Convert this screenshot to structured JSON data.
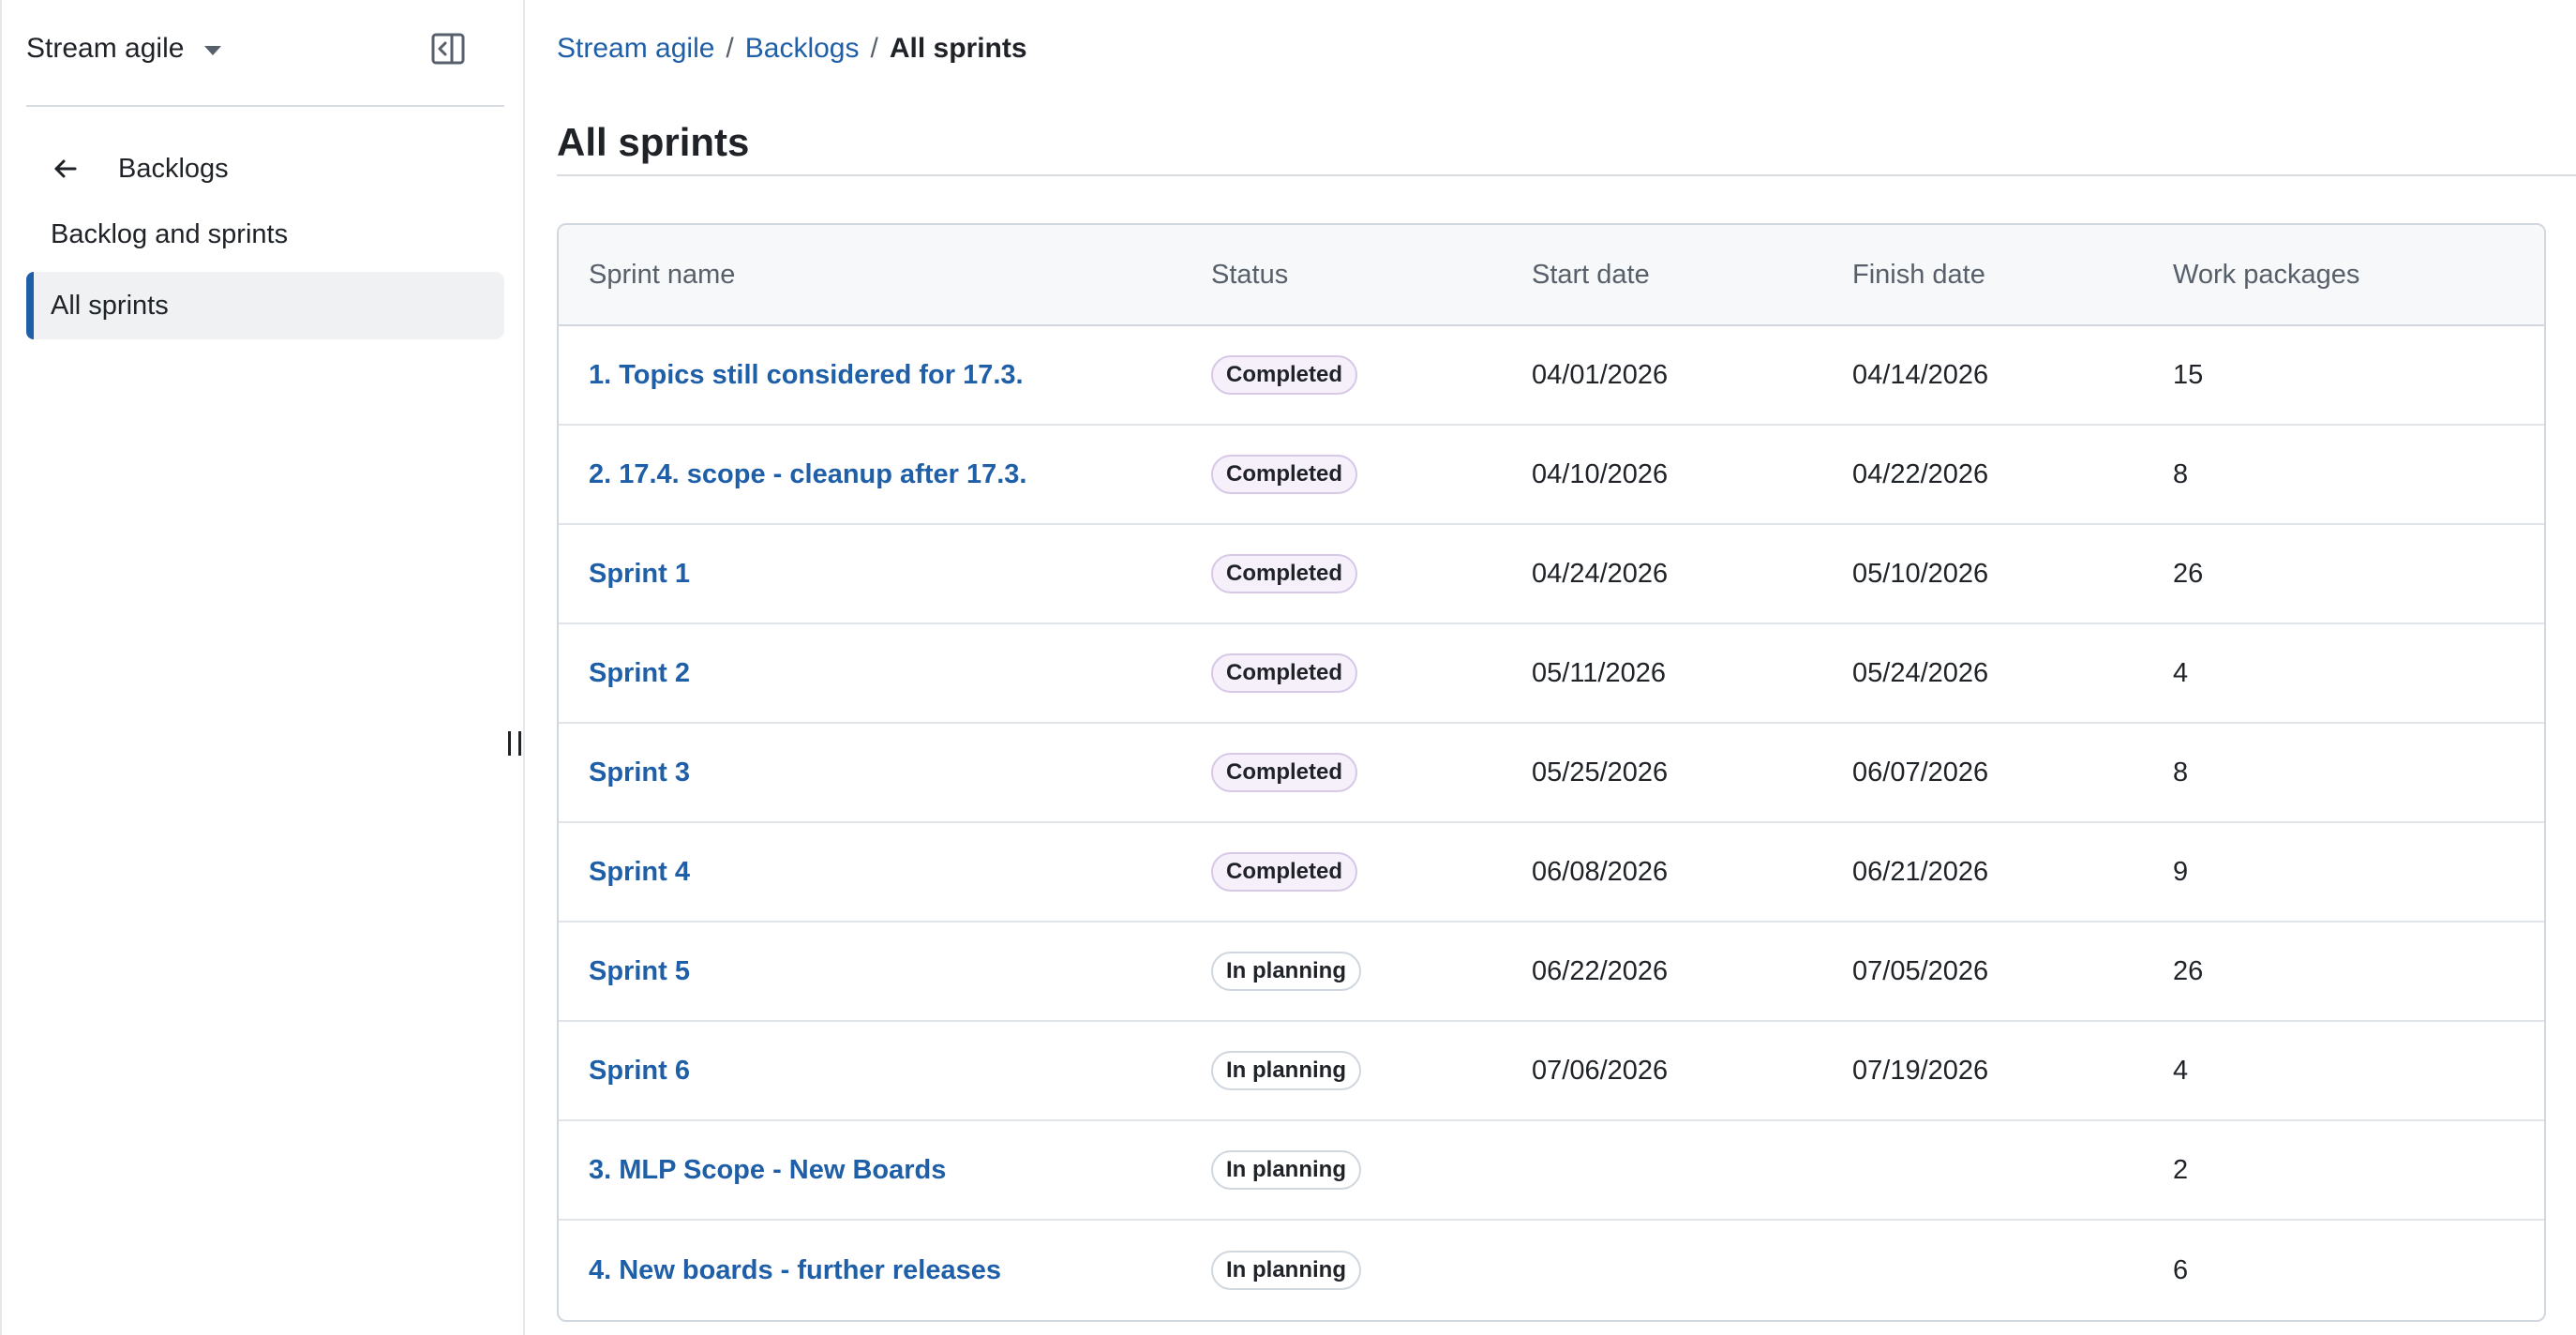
{
  "sidebar": {
    "project_name": "Stream agile",
    "back_label": "Backlogs",
    "nav": [
      {
        "label": "Backlog and sprints",
        "active": false
      },
      {
        "label": "All sprints",
        "active": true
      }
    ]
  },
  "breadcrumb": {
    "items": [
      "Stream agile",
      "Backlogs"
    ],
    "current": "All sprints",
    "separator": "/"
  },
  "page": {
    "title": "All sprints"
  },
  "table": {
    "headers": [
      "Sprint name",
      "Status",
      "Start date",
      "Finish date",
      "Work packages"
    ],
    "rows": [
      {
        "name": "1. Topics still considered for 17.3.",
        "status": "Completed",
        "start": "04/01/2026",
        "finish": "04/14/2026",
        "work_packages": "15"
      },
      {
        "name": "2. 17.4. scope - cleanup after 17.3.",
        "status": "Completed",
        "start": "04/10/2026",
        "finish": "04/22/2026",
        "work_packages": "8"
      },
      {
        "name": "Sprint 1",
        "status": "Completed",
        "start": "04/24/2026",
        "finish": "05/10/2026",
        "work_packages": "26"
      },
      {
        "name": "Sprint 2",
        "status": "Completed",
        "start": "05/11/2026",
        "finish": "05/24/2026",
        "work_packages": "4"
      },
      {
        "name": "Sprint 3",
        "status": "Completed",
        "start": "05/25/2026",
        "finish": "06/07/2026",
        "work_packages": "8"
      },
      {
        "name": "Sprint 4",
        "status": "Completed",
        "start": "06/08/2026",
        "finish": "06/21/2026",
        "work_packages": "9"
      },
      {
        "name": "Sprint 5",
        "status": "In planning",
        "start": "06/22/2026",
        "finish": "07/05/2026",
        "work_packages": "26"
      },
      {
        "name": "Sprint 6",
        "status": "In planning",
        "start": "07/06/2026",
        "finish": "07/19/2026",
        "work_packages": "4"
      },
      {
        "name": "3. MLP Scope - New Boards",
        "status": "In planning",
        "start": "",
        "finish": "",
        "work_packages": "2"
      },
      {
        "name": "4. New boards - further releases",
        "status": "In planning",
        "start": "",
        "finish": "",
        "work_packages": "6"
      }
    ]
  },
  "icons": {
    "project_caret": "caret-down-icon",
    "collapse": "sidebar-collapse-icon",
    "back": "arrow-left-icon",
    "resize": "resize-handle-icon"
  },
  "colors": {
    "link": "#1f5fa8",
    "active_indicator": "#1f5fa8",
    "header_bg": "#f6f8fa",
    "completed_badge_bg": "#f6f0fb"
  }
}
